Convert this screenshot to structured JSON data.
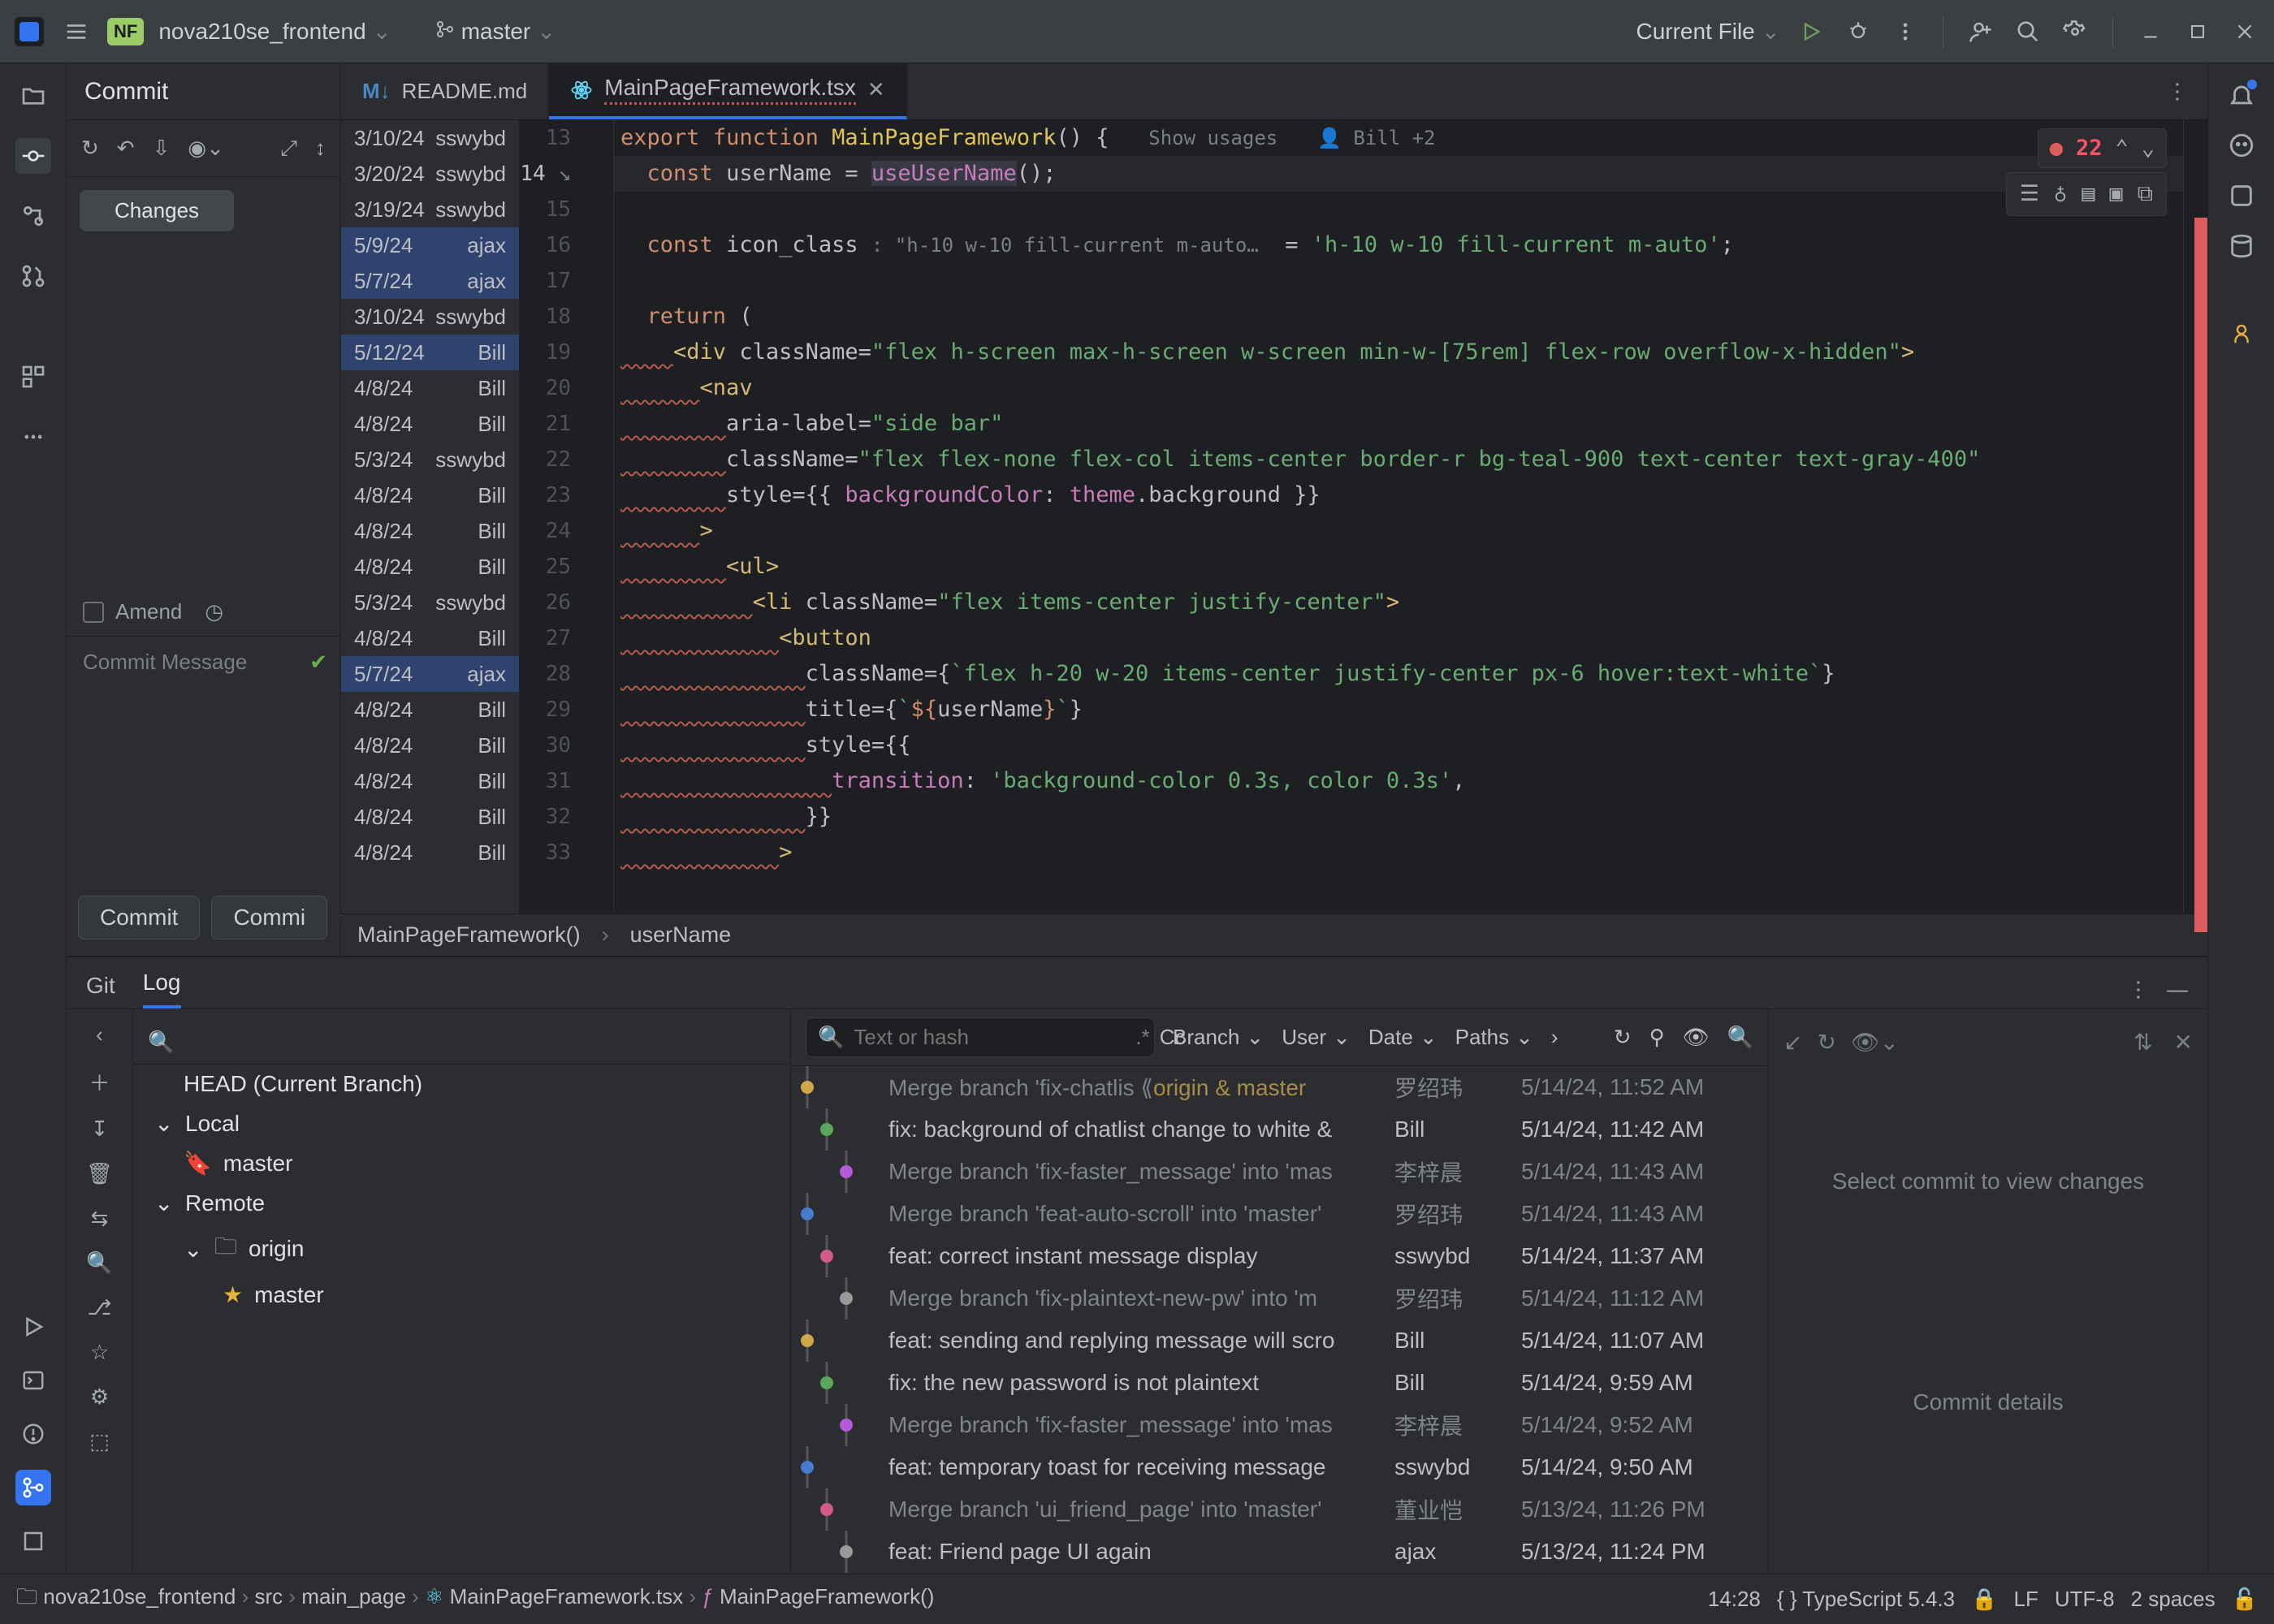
{
  "topbar": {
    "project_badge": "NF",
    "project_name": "nova210se_frontend",
    "branch": "master",
    "run_config": "Current File"
  },
  "commit": {
    "title": "Commit",
    "changes_label": "Changes",
    "amend_label": "Amend",
    "message_placeholder": "Commit Message",
    "btn_commit": "Commit",
    "btn_commit_and": "Commi"
  },
  "tabs": [
    {
      "name": "README.md",
      "active": false,
      "icon": "md"
    },
    {
      "name": "MainPageFramework.tsx",
      "active": true,
      "icon": "react"
    }
  ],
  "inline": {
    "usages": "Show usages",
    "author": "Bill +2",
    "error_count": "22",
    "type_hint": ": \"h-10 w-10 fill-current m-auto…"
  },
  "blame": [
    {
      "date": "3/10/24",
      "author": "sswybd",
      "sel": false
    },
    {
      "date": "3/20/24",
      "author": "sswybd",
      "sel": false
    },
    {
      "date": "3/19/24",
      "author": "sswybd",
      "sel": false
    },
    {
      "date": "5/9/24",
      "author": "ajax",
      "sel": true
    },
    {
      "date": "5/7/24",
      "author": "ajax",
      "sel": true
    },
    {
      "date": "3/10/24",
      "author": "sswybd",
      "sel": false
    },
    {
      "date": "5/12/24",
      "author": "Bill",
      "sel": true
    },
    {
      "date": "4/8/24",
      "author": "Bill",
      "sel": false
    },
    {
      "date": "4/8/24",
      "author": "Bill",
      "sel": false
    },
    {
      "date": "5/3/24",
      "author": "sswybd",
      "sel": false
    },
    {
      "date": "4/8/24",
      "author": "Bill",
      "sel": false
    },
    {
      "date": "4/8/24",
      "author": "Bill",
      "sel": false
    },
    {
      "date": "4/8/24",
      "author": "Bill",
      "sel": false
    },
    {
      "date": "5/3/24",
      "author": "sswybd",
      "sel": false
    },
    {
      "date": "4/8/24",
      "author": "Bill",
      "sel": false
    },
    {
      "date": "5/7/24",
      "author": "ajax",
      "sel": true
    },
    {
      "date": "4/8/24",
      "author": "Bill",
      "sel": false
    },
    {
      "date": "4/8/24",
      "author": "Bill",
      "sel": false
    },
    {
      "date": "4/8/24",
      "author": "Bill",
      "sel": false
    },
    {
      "date": "4/8/24",
      "author": "Bill",
      "sel": false
    },
    {
      "date": "4/8/24",
      "author": "Bill",
      "sel": false
    }
  ],
  "line_start": 13,
  "selected_line": 14,
  "breadcrumb_editor": [
    "MainPageFramework()",
    "userName"
  ],
  "git": {
    "tabs": {
      "git": "Git",
      "log": "Log",
      "active": "log"
    },
    "head": "HEAD (Current Branch)",
    "local": "Local",
    "remote": "Remote",
    "origin": "origin",
    "master": "master",
    "search_placeholder": "Text or hash",
    "filters": {
      "branch": "Branch",
      "user": "User",
      "date": "Date",
      "paths": "Paths"
    },
    "details_msg": "Select commit to view changes",
    "details_title": "Commit details"
  },
  "commits": [
    {
      "msg": "Merge branch 'fix-chatlis",
      "tag": "origin & master",
      "author": "罗绍玮",
      "date": "5/14/24, 11:52 AM",
      "dim": true
    },
    {
      "msg": "fix: background of chatlist change to white &",
      "author": "Bill",
      "date": "5/14/24, 11:42 AM",
      "dim": false
    },
    {
      "msg": "Merge branch 'fix-faster_message' into 'mas",
      "author": "李梓晨",
      "date": "5/14/24, 11:43 AM",
      "dim": true
    },
    {
      "msg": "Merge branch 'feat-auto-scroll' into 'master'",
      "author": "罗绍玮",
      "date": "5/14/24, 11:43 AM",
      "dim": true
    },
    {
      "msg": "feat: correct instant message display",
      "author": "sswybd",
      "date": "5/14/24, 11:37 AM",
      "dim": false
    },
    {
      "msg": "Merge branch 'fix-plaintext-new-pw' into 'm",
      "author": "罗绍玮",
      "date": "5/14/24, 11:12 AM",
      "dim": true
    },
    {
      "msg": "feat: sending and replying message will scro",
      "author": "Bill",
      "date": "5/14/24, 11:07 AM",
      "dim": false
    },
    {
      "msg": "fix: the new password is not plaintext",
      "author": "Bill",
      "date": "5/14/24, 9:59 AM",
      "dim": false
    },
    {
      "msg": "Merge branch 'fix-faster_message' into 'mas",
      "author": "李梓晨",
      "date": "5/14/24, 9:52 AM",
      "dim": true
    },
    {
      "msg": "feat: temporary toast for receiving message",
      "author": "sswybd",
      "date": "5/14/24, 9:50 AM",
      "dim": false
    },
    {
      "msg": "Merge branch 'ui_friend_page' into 'master'",
      "author": "董业恺",
      "date": "5/13/24, 11:26 PM",
      "dim": true
    },
    {
      "msg": "feat: Friend page UI again",
      "author": "ajax",
      "date": "5/13/24, 11:24 PM",
      "dim": false
    }
  ],
  "status": {
    "path": [
      "nova210se_frontend",
      "src",
      "main_page",
      "MainPageFramework.tsx",
      "MainPageFramework()"
    ],
    "time": "14:28",
    "lang": "TypeScript 5.4.3",
    "line_sep": "LF",
    "enc": "UTF-8",
    "indent": "2 spaces"
  }
}
